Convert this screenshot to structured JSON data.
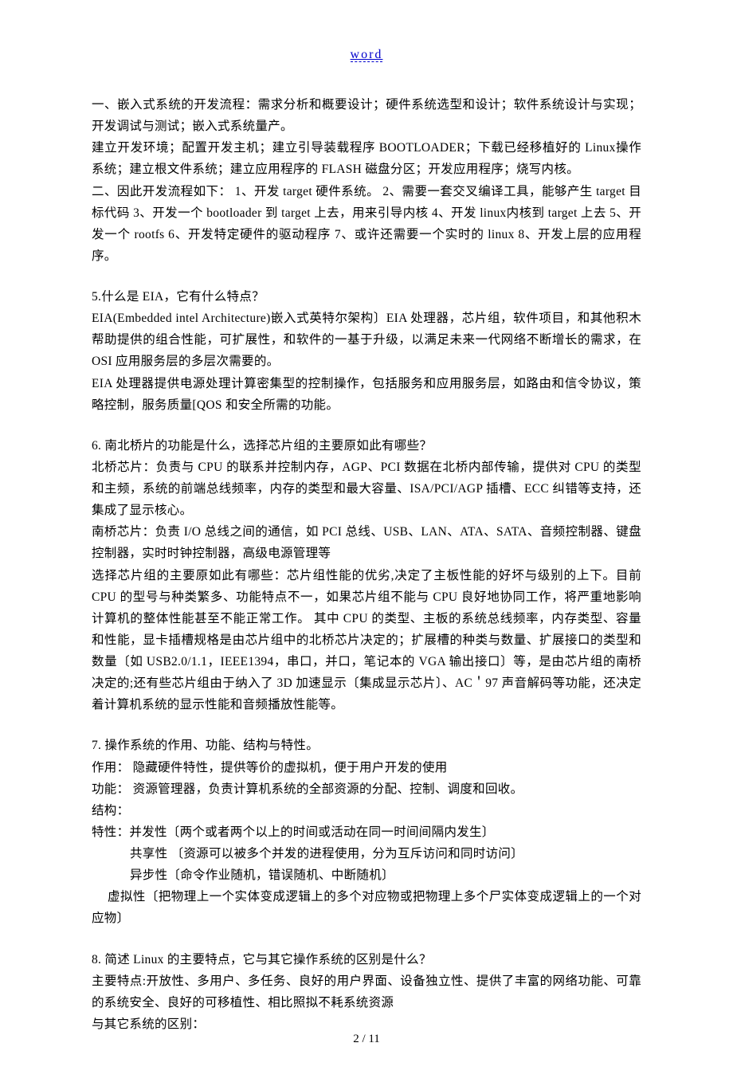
{
  "header": {
    "link": "word"
  },
  "body": {
    "block1": {
      "p1": "一、嵌入式系统的开发流程：需求分析和概要设计；硬件系统选型和设计；软件系统设计与实现；开发调试与测试；嵌入式系统量产。",
      "p2": "建立开发环境；配置开发主机；建立引导装载程序 BOOTLOADER；下载已经移植好的 Linux操作系统；建立根文件系统；建立应用程序的 FLASH 磁盘分区；开发应用程序；烧写内核。",
      "p3": "二、因此开发流程如下：  1、开发 target 硬件系统。  2、需要一套交叉编译工具，能够产生 target 目标代码  3、开发一个 bootloader 到 target 上去，用来引导内核    4、开发 linux内核到 target 上去  5、开发一个 rootfs  6、开发特定硬件的驱动程序  7、或许还需要一个实时的 linux    8、开发上层的应用程序。"
    },
    "block2": {
      "q": "5.什么是 EIA，它有什么特点？",
      "p1": "EIA(Embedded intel Architecture)嵌入式英特尔架构〕EIA 处理器，芯片组，软件项目，和其他积木帮助提供的组合性能，可扩展性，和软件的一基于升级，以满足未来一代网络不断增长的需求，在 OSI 应用服务层的多层次需要的。",
      "p2": "EIA 处理器提供电源处理计算密集型的控制操作，包括服务和应用服务层，如路由和信令协议，策略控制，服务质量[QOS 和安全所需的功能。"
    },
    "block3": {
      "q": "6.  南北桥片的功能是什么，选择芯片组的主要原如此有哪些？",
      "p1": "北桥芯片：负责与 CPU 的联系并控制内存，AGP、PCI 数据在北桥内部传输，提供对 CPU 的类型和主频，系统的前端总线频率，内存的类型和最大容量、ISA/PCI/AGP 插槽、ECC 纠错等支持，还集成了显示核心。",
      "p2": "南桥芯片：负责 I/O 总线之间的通信，如 PCI 总线、USB、LAN、ATA、SATA、音频控制器、键盘控制器，实时时钟控制器，高级电源管理等",
      "p3": "选择芯片组的主要原如此有哪些：芯片组性能的优劣,决定了主板性能的好坏与级别的上下。目前 CPU 的型号与种类繁多、功能特点不一，如果芯片组不能与 CPU 良好地协同工作，将严重地影响计算机的整体性能甚至不能正常工作。  其中 CPU 的类型、主板的系统总线频率，内存类型、容量和性能，显卡插槽规格是由芯片组中的北桥芯片决定的；扩展槽的种类与数量、扩展接口的类型和数量〔如 USB2.0/1.1，IEEE1394，串口，并口，笔记本的 VGA 输出接口〕等，是由芯片组的南桥决定的;还有些芯片组由于纳入了 3D 加速显示〔集成显示芯片〕、AC＇97 声音解码等功能，还决定着计算机系统的显示性能和音频播放性能等。"
    },
    "block4": {
      "q": "7.  操作系统的作用、功能、结构与特性。",
      "p1": "作用：  隐藏硬件特性，提供等价的虚拟机，便于用户开发的使用",
      "p2": "功能：  资源管理器，负责计算机系统的全部资源的分配、控制、调度和回收。",
      "p3": "结构：",
      "p4": "特性：并发性〔两个或者两个以上的时间或活动在同一时间间隔内发生〕",
      "p5": "共享性 〔资源可以被多个并发的进程使用，分为互斥访问和同时访问〕",
      "p6": "异步性〔命令作业随机，错误随机、中断随机〕",
      "p7": "虚拟性〔把物理上一个实体变成逻辑上的多个对应物或把物理上多个尸实体变成逻辑上的一个对应物〕"
    },
    "block5": {
      "q": "8.  简述 Linux 的主要特点，它与其它操作系统的区别是什么？",
      "p1": "主要特点:开放性、多用户、多任务、良好的用户界面、设备独立性、提供了丰富的网络功能、可靠的系统安全、良好的可移植性、相比照拟不耗系统资源",
      "p2": "与其它系统的区别："
    }
  },
  "footer": {
    "page": "2 / 11"
  }
}
